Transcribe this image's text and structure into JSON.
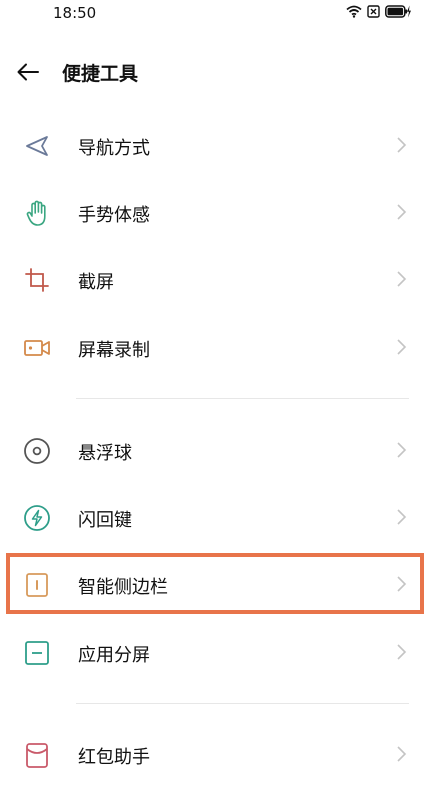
{
  "status_bar": {
    "time": "18:50",
    "battery_level": 1.0
  },
  "header": {
    "title": "便捷工具"
  },
  "items": [
    {
      "label": "导航方式",
      "icon": "navigation-icon",
      "color": "#6b7a99"
    },
    {
      "label": "手势体感",
      "icon": "gesture-hand-icon",
      "color": "#3aa681"
    },
    {
      "label": "截屏",
      "icon": "crop-icon",
      "color": "#c0584a"
    },
    {
      "label": "屏幕录制",
      "icon": "video-record-icon",
      "color": "#d4894a"
    },
    {
      "label": "悬浮球",
      "icon": "floating-ball-icon",
      "color": "#555555"
    },
    {
      "label": "闪回键",
      "icon": "flash-back-icon",
      "color": "#2e9e8a"
    },
    {
      "label": "智能侧边栏",
      "icon": "sidebar-icon",
      "color": "#d79a5c"
    },
    {
      "label": "应用分屏",
      "icon": "split-screen-icon",
      "color": "#2e9e8a"
    },
    {
      "label": "红包助手",
      "icon": "red-envelope-icon",
      "color": "#c95a6a"
    }
  ],
  "colors": {
    "highlight": "#e8744a",
    "chevron": "#c4c4c4"
  }
}
